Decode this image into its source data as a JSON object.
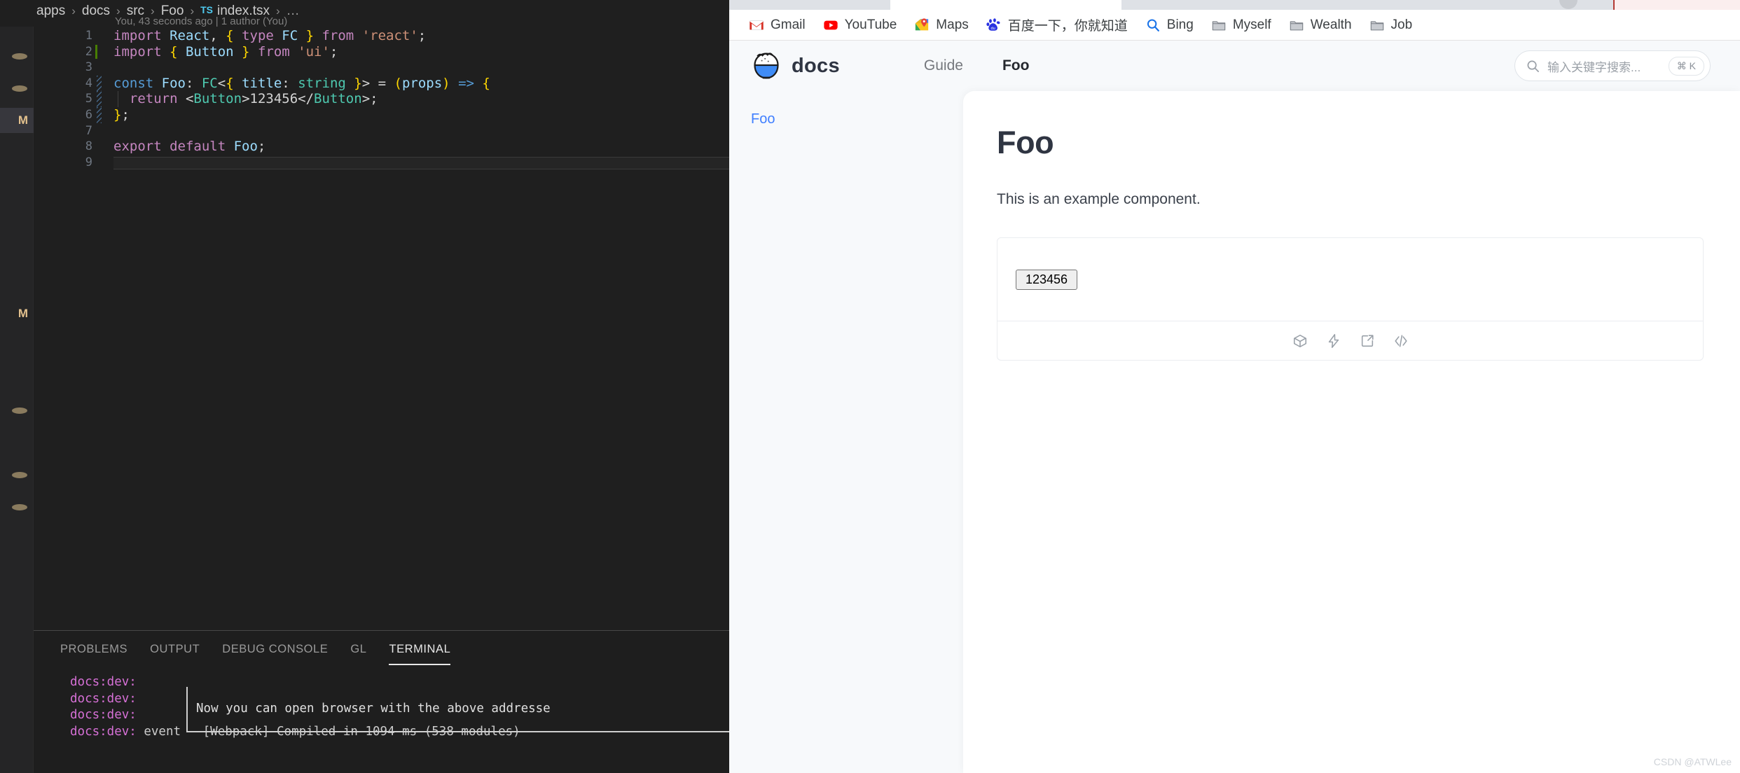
{
  "editor": {
    "breadcrumb": {
      "segments": [
        "apps",
        "docs",
        "src",
        "Foo"
      ],
      "file_badge": "TS",
      "file_name": "index.tsx",
      "trailing": "…"
    },
    "blame": "You, 43 seconds ago | 1 author (You)",
    "lines": [
      {
        "n": "1",
        "tokens": [
          {
            "t": "import ",
            "c": "kw"
          },
          {
            "t": "React",
            "c": "var"
          },
          {
            "t": ", ",
            "c": "plain"
          },
          {
            "t": "{ ",
            "c": "br"
          },
          {
            "t": "type ",
            "c": "kw"
          },
          {
            "t": "FC",
            "c": "var"
          },
          {
            "t": " }",
            "c": "br"
          },
          {
            "t": " from ",
            "c": "kw"
          },
          {
            "t": "'react'",
            "c": "str"
          },
          {
            "t": ";",
            "c": "plain"
          }
        ]
      },
      {
        "n": "2",
        "tokens": [
          {
            "t": "import ",
            "c": "kw"
          },
          {
            "t": "{ ",
            "c": "br"
          },
          {
            "t": "Button",
            "c": "var"
          },
          {
            "t": " }",
            "c": "br"
          },
          {
            "t": " from ",
            "c": "kw"
          },
          {
            "t": "'ui'",
            "c": "str"
          },
          {
            "t": ";",
            "c": "plain"
          }
        ]
      },
      {
        "n": "3",
        "tokens": []
      },
      {
        "n": "4",
        "tokens": [
          {
            "t": "const ",
            "c": "blue"
          },
          {
            "t": "Foo",
            "c": "var"
          },
          {
            "t": ": ",
            "c": "plain"
          },
          {
            "t": "FC",
            "c": "type"
          },
          {
            "t": "<",
            "c": "plain"
          },
          {
            "t": "{ ",
            "c": "br"
          },
          {
            "t": "title",
            "c": "var"
          },
          {
            "t": ": ",
            "c": "plain"
          },
          {
            "t": "string",
            "c": "type"
          },
          {
            "t": " }",
            "c": "br"
          },
          {
            "t": "> ",
            "c": "plain"
          },
          {
            "t": "= ",
            "c": "plain"
          },
          {
            "t": "(",
            "c": "br"
          },
          {
            "t": "props",
            "c": "var"
          },
          {
            "t": ")",
            "c": "br"
          },
          {
            "t": " ",
            "c": "plain"
          },
          {
            "t": "=>",
            "c": "blue"
          },
          {
            "t": " ",
            "c": "plain"
          },
          {
            "t": "{",
            "c": "br"
          }
        ]
      },
      {
        "n": "5",
        "tokens": [
          {
            "t": "  ",
            "c": "plain"
          },
          {
            "t": "return ",
            "c": "kw"
          },
          {
            "t": "<",
            "c": "plain"
          },
          {
            "t": "Button",
            "c": "tag"
          },
          {
            "t": ">",
            "c": "plain"
          },
          {
            "t": "123456",
            "c": "plain"
          },
          {
            "t": "</",
            "c": "plain"
          },
          {
            "t": "Button",
            "c": "tag"
          },
          {
            "t": ">",
            "c": "plain"
          },
          {
            "t": ";",
            "c": "plain"
          }
        ]
      },
      {
        "n": "6",
        "tokens": [
          {
            "t": "}",
            "c": "br"
          },
          {
            "t": ";",
            "c": "plain"
          }
        ]
      },
      {
        "n": "7",
        "tokens": []
      },
      {
        "n": "8",
        "tokens": [
          {
            "t": "export ",
            "c": "kw"
          },
          {
            "t": "default ",
            "c": "kw"
          },
          {
            "t": "Foo",
            "c": "var"
          },
          {
            "t": ";",
            "c": "plain"
          }
        ]
      },
      {
        "n": "9",
        "tokens": []
      }
    ],
    "explorer_rows": [
      {
        "kind": "dot",
        "selected": false
      },
      {
        "kind": "dot",
        "selected": false
      },
      {
        "kind": "m",
        "label": "M",
        "selected": true
      },
      {
        "kind": "blank",
        "selected": false
      },
      {
        "kind": "blank",
        "selected": false
      },
      {
        "kind": "blank",
        "selected": false
      },
      {
        "kind": "blank",
        "selected": false
      },
      {
        "kind": "blank",
        "selected": false
      },
      {
        "kind": "m",
        "label": "M",
        "selected": false
      },
      {
        "kind": "blank",
        "selected": false
      },
      {
        "kind": "blank",
        "selected": false
      },
      {
        "kind": "dot",
        "selected": false
      },
      {
        "kind": "blank",
        "selected": false
      },
      {
        "kind": "dot",
        "selected": false
      },
      {
        "kind": "dot",
        "selected": false
      }
    ]
  },
  "panel": {
    "tabs": [
      {
        "label": "PROBLEMS",
        "active": false
      },
      {
        "label": "OUTPUT",
        "active": false
      },
      {
        "label": "DEBUG CONSOLE",
        "active": false
      },
      {
        "label": "GL",
        "active": false
      },
      {
        "label": "TERMINAL",
        "active": true
      }
    ],
    "terminal": {
      "lines": [
        {
          "prefix": "docs:dev:",
          "text": ""
        },
        {
          "prefix": "docs:dev:",
          "text": ""
        },
        {
          "prefix": "docs:dev:",
          "text": ""
        },
        {
          "prefix": "docs:dev:",
          "text": " event - [Webpack] Compiled in 1094 ms (538 modules)"
        }
      ],
      "boxed_message": "Now you can open browser with the above addresse"
    }
  },
  "browser": {
    "bookmarks": [
      {
        "label": "Gmail",
        "icon": "gmail-icon"
      },
      {
        "label": "YouTube",
        "icon": "youtube-icon"
      },
      {
        "label": "Maps",
        "icon": "google-maps-icon"
      },
      {
        "label": "百度一下，你就知道",
        "icon": "baidu-icon"
      },
      {
        "label": "Bing",
        "icon": "bing-icon"
      },
      {
        "label": "Myself",
        "icon": "folder-icon"
      },
      {
        "label": "Wealth",
        "icon": "folder-icon"
      },
      {
        "label": "Job",
        "icon": "folder-icon"
      }
    ]
  },
  "site": {
    "logo_text": "docs",
    "nav": [
      {
        "label": "Guide",
        "active": false
      },
      {
        "label": "Foo",
        "active": true
      }
    ],
    "search": {
      "placeholder": "输入关键字搜索...",
      "shortcut": "⌘ K"
    },
    "sidebar": {
      "items": [
        {
          "label": "Foo",
          "active": true
        }
      ]
    },
    "content": {
      "title": "Foo",
      "paragraph": "This is an example component.",
      "demo_button_label": "123456",
      "toolbar_icons": [
        {
          "name": "codesandbox-icon"
        },
        {
          "name": "stackblitz-icon"
        },
        {
          "name": "external-link-icon"
        },
        {
          "name": "code-icon"
        }
      ]
    }
  },
  "watermark": "CSDN @ATWLee",
  "colors": {
    "accent_blue": "#3f7fff",
    "editor_bg": "#1f1f1f",
    "site_bg": "#f7f9fb"
  }
}
